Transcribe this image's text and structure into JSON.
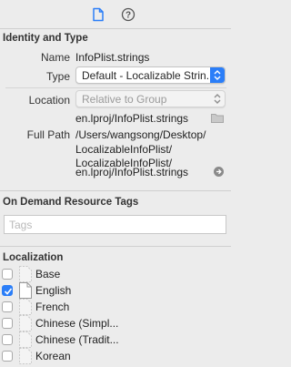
{
  "toolbar": {
    "file_inspector_icon": "document-icon",
    "quick_help_icon": "question-mark-circle-icon"
  },
  "identity": {
    "title": "Identity and Type",
    "name_label": "Name",
    "name_value": "InfoPlist.strings",
    "type_label": "Type",
    "type_value": "Default - Localizable Strin...",
    "location_label": "Location",
    "location_value": "Relative to Group",
    "relative_path": "en.lproj/InfoPlist.strings",
    "full_path_label": "Full Path",
    "full_path_lines": [
      "/Users/wangsong/Desktop/",
      "LocalizableInfoPlist/",
      "LocalizableInfoPlist/",
      "en.lproj/InfoPlist.strings"
    ]
  },
  "on_demand": {
    "title": "On Demand Resource Tags",
    "tags_placeholder": "Tags"
  },
  "localization": {
    "title": "Localization",
    "items": [
      {
        "label": "Base",
        "checked": false
      },
      {
        "label": "English",
        "checked": true
      },
      {
        "label": "French",
        "checked": false
      },
      {
        "label": "Chinese (Simpl...",
        "checked": false
      },
      {
        "label": "Chinese (Tradit...",
        "checked": false
      },
      {
        "label": "Korean",
        "checked": false
      }
    ]
  },
  "colors": {
    "accent": "#2b7ef8",
    "background": "#ececec"
  }
}
